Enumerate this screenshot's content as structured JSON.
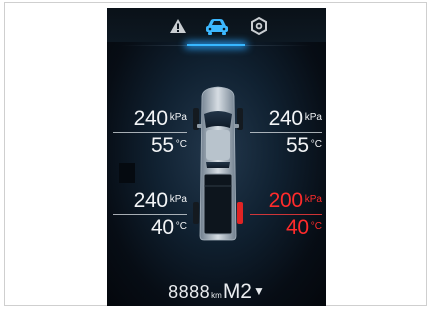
{
  "tabs": [
    {
      "icon": "warning-icon",
      "active": false
    },
    {
      "icon": "car-icon",
      "active": true
    },
    {
      "icon": "settings-icon",
      "active": false
    }
  ],
  "colors": {
    "active_tab": "#37b7ff",
    "alert": "#ff2b2b",
    "text": "#f2f4f6"
  },
  "tires": {
    "front_left": {
      "pressure": "240",
      "pressure_unit": "kPa",
      "temp": "55",
      "temp_unit": "°C"
    },
    "front_right": {
      "pressure": "240",
      "pressure_unit": "kPa",
      "temp": "55",
      "temp_unit": "°C"
    },
    "rear_left": {
      "pressure": "240",
      "pressure_unit": "kPa",
      "temp": "40",
      "temp_unit": "°C"
    },
    "rear_right": {
      "pressure": "200",
      "pressure_unit": "kPa",
      "temp": "40",
      "temp_unit": "°C",
      "alert": true
    }
  },
  "status_bar": {
    "odometer": "8888",
    "odometer_unit": "km",
    "gear_mode": "M2",
    "dropdown_icon": "chevron-down-icon"
  }
}
